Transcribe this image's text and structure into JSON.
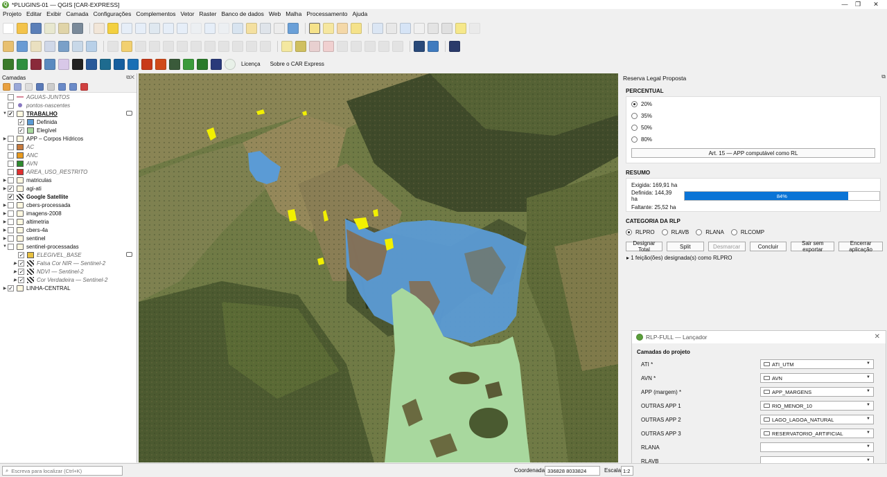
{
  "window": {
    "title": "*PLUGINS-01 — QGIS [CAR-EXPRESS]"
  },
  "menu": [
    "Projeto",
    "Editar",
    "Exibir",
    "Camada",
    "Configurações",
    "Complementos",
    "Vetor",
    "Raster",
    "Banco de dados",
    "Web",
    "Malha",
    "Processamento",
    "Ajuda"
  ],
  "plugin_toolbar": {
    "license_label": "Licença",
    "about_label": "Sobre o CAR Express"
  },
  "layers_panel": {
    "title": "Camadas",
    "layers": [
      {
        "name": "AGUAS-JUNTOS",
        "checked": false,
        "style": "it",
        "symbol": "line",
        "expand": ""
      },
      {
        "name": "pontos-nascentes",
        "checked": false,
        "style": "it",
        "symbol": "dot",
        "expand": ""
      },
      {
        "name": "TRABALHO",
        "checked": true,
        "style": "b u",
        "symbol": "grp",
        "expand": "▼"
      },
      {
        "name": "Definida",
        "checked": true,
        "style": "",
        "symbol": "fill",
        "color": "#5b9bd5",
        "indent": 2
      },
      {
        "name": "Elegível",
        "checked": true,
        "style": "",
        "symbol": "fill",
        "color": "#a8d89e",
        "indent": 2
      },
      {
        "name": "APP – Corpos Hídricos",
        "checked": false,
        "style": "",
        "symbol": "grp",
        "expand": "▶"
      },
      {
        "name": "AC",
        "checked": false,
        "style": "it",
        "symbol": "fill",
        "color": "#c77a3d"
      },
      {
        "name": "ANC",
        "checked": false,
        "style": "it",
        "symbol": "fill",
        "color": "#e89a1e"
      },
      {
        "name": "AVN",
        "checked": false,
        "style": "it",
        "symbol": "fill",
        "color": "#2e8b2e"
      },
      {
        "name": "AREA_USO_RESTRITO",
        "checked": false,
        "style": "it",
        "symbol": "fill",
        "color": "#e03030"
      },
      {
        "name": "matriculas",
        "checked": false,
        "style": "",
        "symbol": "grp",
        "expand": "▶"
      },
      {
        "name": "agi-ati",
        "checked": true,
        "style": "",
        "symbol": "grp",
        "expand": "▶"
      },
      {
        "name": "Google Satellite",
        "checked": true,
        "style": "b",
        "symbol": "rast",
        "expand": ""
      },
      {
        "name": "cbers-processada",
        "checked": false,
        "style": "",
        "symbol": "grp",
        "expand": "▶"
      },
      {
        "name": "imagens-2008",
        "checked": false,
        "style": "",
        "symbol": "grp",
        "expand": "▶"
      },
      {
        "name": "altimetria",
        "checked": false,
        "style": "",
        "symbol": "grp",
        "expand": "▶"
      },
      {
        "name": "cbers-4a",
        "checked": false,
        "style": "",
        "symbol": "grp",
        "expand": "▶"
      },
      {
        "name": "sentinel",
        "checked": false,
        "style": "",
        "symbol": "grp",
        "expand": "▶"
      },
      {
        "name": "sentinel-processadas",
        "checked": false,
        "style": "",
        "symbol": "grp",
        "expand": "▼"
      },
      {
        "name": "ELEGIVEL_BASE",
        "checked": true,
        "style": "it",
        "symbol": "fill",
        "color": "#e8c040",
        "indent": 2
      },
      {
        "name": "Falsa Cor NIR — Sentinel-2",
        "checked": true,
        "style": "it",
        "symbol": "rast",
        "indent": 2,
        "expand": "▶"
      },
      {
        "name": "NDVI — Sentinel-2",
        "checked": true,
        "style": "it",
        "symbol": "rast",
        "indent": 2,
        "expand": "▶"
      },
      {
        "name": "Cor Verdadeira — Sentinel-2",
        "checked": true,
        "style": "it",
        "symbol": "rast",
        "indent": 2,
        "expand": "▶"
      },
      {
        "name": "LINHA-CENTRAL",
        "checked": true,
        "style": "",
        "symbol": "grp",
        "expand": "▶"
      }
    ]
  },
  "rl_panel": {
    "title": "Reserva Legal Proposta",
    "percentual_header": "PERCENTUAL",
    "percent_options": [
      "20%",
      "35%",
      "50%",
      "80%"
    ],
    "selected_percent": "20%",
    "art_button": "Art. 15 — APP computável como RL",
    "resumo_header": "RESUMO",
    "exigida": "Exigida: 169,91 ha",
    "definida": "Definida: 144,39 ha",
    "faltante": "Faltante: 25,52 ha",
    "progress_text": "84%",
    "progress_fraction": 0.84,
    "categoria_header": "CATEGORIA DA RLP",
    "categories": [
      "RLPRO",
      "RLAVB",
      "RLANA",
      "RLCOMP"
    ],
    "selected_category": "RLPRO",
    "actions": {
      "designar": "Designar Total",
      "split": "Split",
      "desmarcar": "Desmarcar",
      "concluir": "Concluir",
      "sair": "Sair sem exportar",
      "encerrar": "Encerrar aplicação"
    },
    "status_msg": "▸ 1 feição(ões) designada(s) como RLPRO"
  },
  "launcher": {
    "title": "RLP-FULL — Lançador",
    "section": "Camadas do projeto",
    "rows": [
      {
        "label": "ATI *",
        "value": "ATI_UTM"
      },
      {
        "label": "AVN *",
        "value": "AVN"
      },
      {
        "label": "APP (margem) *",
        "value": "APP_MARGENS"
      },
      {
        "label": "OUTRAS APP 1",
        "value": "RIO_MENOR_10"
      },
      {
        "label": "OUTRAS APP 2",
        "value": "LAGO_LAGOA_NATURAL"
      },
      {
        "label": "OUTRAS APP 3",
        "value": "RESERVATORIO_ARTIFICIAL"
      },
      {
        "label": "RLANA",
        "value": ""
      },
      {
        "label": "RLAVB",
        "value": ""
      }
    ]
  },
  "statusbar": {
    "search_placeholder": "Escreva para localizar (Ctrl+K)",
    "coord_label": "Coordenada",
    "coord_value": "336828  8033824",
    "scale_label": "Escala",
    "scale_value": "1:2"
  },
  "colors": {
    "definida": "#5b9bd5",
    "elegivel": "#a8d89e",
    "highlight": "#f2f000",
    "progress": "#0a74d6"
  }
}
